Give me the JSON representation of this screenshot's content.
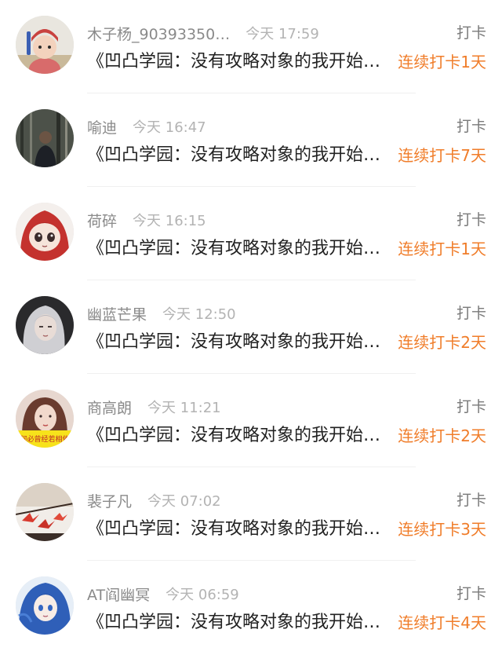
{
  "feed": {
    "items": [
      {
        "username": "木子杨_90393350…",
        "time": "今天 17:59",
        "type": "打卡",
        "content": "《凹凸学园：没有攻略对象的我开始打卡",
        "streak": "连续打卡1天",
        "avatar": "child-in-red-hat-avatar"
      },
      {
        "username": "喻迪",
        "time": "今天 16:47",
        "type": "打卡",
        "content": "《凹凸学园：没有攻略对象的我开始打卡",
        "streak": "连续打卡7天",
        "avatar": "person-in-forest-avatar"
      },
      {
        "username": "荷碎",
        "time": "今天 16:15",
        "type": "打卡",
        "content": "《凹凸学园：没有攻略对象的我开始打卡",
        "streak": "连续打卡1天",
        "avatar": "red-hair-anime-girl-avatar"
      },
      {
        "username": "幽蓝芒果",
        "time": "今天 12:50",
        "type": "打卡",
        "content": "《凹凸学园：没有攻略对象的我开始打卡",
        "streak": "连续打卡2天",
        "avatar": "silver-hair-girl-avatar"
      },
      {
        "username": "商高朗",
        "time": "今天 11:21",
        "type": "打卡",
        "content": "《凹凸学园：没有攻略对象的我开始打卡",
        "streak": "连续打卡2天",
        "avatar": "portrait-with-caption-avatar",
        "avatar_caption": "何必曾经若相依"
      },
      {
        "username": "裴子凡",
        "time": "今天 07:02",
        "type": "打卡",
        "content": "《凹凸学园：没有攻略对象的我开始打卡",
        "streak": "连续打卡3天",
        "avatar": "paper-cranes-avatar"
      },
      {
        "username": "AT阎幽冥",
        "time": "今天 06:59",
        "type": "打卡",
        "content": "《凹凸学园：没有攻略对象的我开始打卡",
        "streak": "连续打卡4天",
        "avatar": "blue-hair-anime-girl-avatar"
      }
    ]
  },
  "colors": {
    "streak": "#f07d2a",
    "username": "#8a8a8a",
    "time": "#b3b3b3",
    "content": "#222222"
  }
}
